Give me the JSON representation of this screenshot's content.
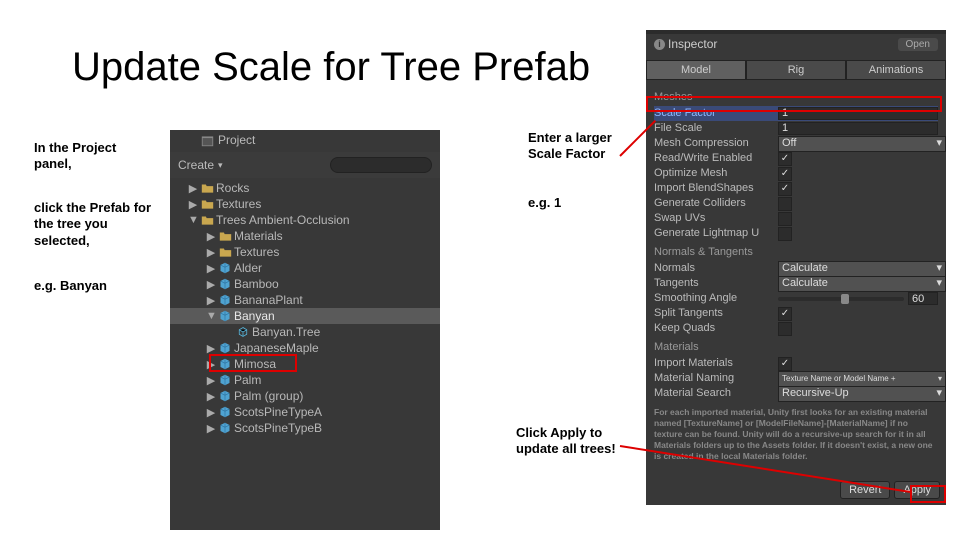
{
  "title": "Update Scale for Tree Prefab",
  "instructions": {
    "left1": "In the Project panel,",
    "left2": "click the Prefab for the tree you selected,",
    "left3": "e.g. Banyan",
    "right1": "Enter a larger Scale Factor",
    "right2": "e.g. 1",
    "right3": "Click Apply to update all trees!"
  },
  "project": {
    "tab": "Project",
    "create": "Create",
    "items": [
      {
        "depth": 2,
        "arrow": "▶",
        "icon": "folder",
        "label": "Rocks"
      },
      {
        "depth": 2,
        "arrow": "▶",
        "icon": "folder",
        "label": "Textures"
      },
      {
        "depth": 2,
        "arrow": "▼",
        "icon": "folder",
        "label": "Trees Ambient-Occlusion"
      },
      {
        "depth": 3,
        "arrow": "▶",
        "icon": "folder",
        "label": "Materials"
      },
      {
        "depth": 3,
        "arrow": "▶",
        "icon": "folder",
        "label": "Textures"
      },
      {
        "depth": 3,
        "arrow": "▶",
        "icon": "prefab",
        "label": "Alder"
      },
      {
        "depth": 3,
        "arrow": "▶",
        "icon": "prefab",
        "label": "Bamboo"
      },
      {
        "depth": 3,
        "arrow": "▶",
        "icon": "prefab",
        "label": "BananaPlant"
      },
      {
        "depth": 3,
        "arrow": "▼",
        "icon": "prefab",
        "label": "Banyan",
        "selected": true
      },
      {
        "depth": 4,
        "arrow": "",
        "icon": "mesh",
        "label": "Banyan.Tree"
      },
      {
        "depth": 3,
        "arrow": "▶",
        "icon": "prefab",
        "label": "JapaneseMaple"
      },
      {
        "depth": 3,
        "arrow": "▶",
        "icon": "prefab",
        "label": "Mimosa"
      },
      {
        "depth": 3,
        "arrow": "▶",
        "icon": "prefab",
        "label": "Palm"
      },
      {
        "depth": 3,
        "arrow": "▶",
        "icon": "prefab",
        "label": "Palm (group)"
      },
      {
        "depth": 3,
        "arrow": "▶",
        "icon": "prefab",
        "label": "ScotsPineTypeA"
      },
      {
        "depth": 3,
        "arrow": "▶",
        "icon": "prefab",
        "label": "ScotsPineTypeB"
      }
    ]
  },
  "inspector": {
    "tab": "Inspector",
    "open": "Open",
    "modelTabs": [
      "Model",
      "Rig",
      "Animations"
    ],
    "activeTab": 0,
    "meshes": {
      "header": "Meshes",
      "scaleFactor": {
        "label": "Scale Factor",
        "value": "1"
      },
      "fileScale": {
        "label": "File Scale",
        "value": "1"
      },
      "meshCompression": {
        "label": "Mesh Compression",
        "value": "Off"
      },
      "readWrite": {
        "label": "Read/Write Enabled",
        "checked": true
      },
      "optimize": {
        "label": "Optimize Mesh",
        "checked": true
      },
      "blend": {
        "label": "Import BlendShapes",
        "checked": true
      },
      "genCol": {
        "label": "Generate Colliders",
        "checked": false
      },
      "swap": {
        "label": "Swap UVs",
        "checked": false
      },
      "lightmap": {
        "label": "Generate Lightmap U",
        "checked": false
      }
    },
    "normals": {
      "header": "Normals & Tangents",
      "normals": {
        "label": "Normals",
        "value": "Calculate"
      },
      "tangents": {
        "label": "Tangents",
        "value": "Calculate"
      },
      "smooth": {
        "label": "Smoothing Angle",
        "value": "60"
      },
      "split": {
        "label": "Split Tangents",
        "checked": true
      },
      "keep": {
        "label": "Keep Quads",
        "checked": false
      }
    },
    "materials": {
      "header": "Materials",
      "import": {
        "label": "Import Materials",
        "checked": true
      },
      "naming": {
        "label": "Material Naming",
        "value": "Texture Name or Model Name +"
      },
      "search": {
        "label": "Material Search",
        "value": "Recursive-Up"
      }
    },
    "hint": "For each imported material, Unity first looks for an existing material named [TextureName] or [ModelFileName]-[MaterialName] if no texture can be found.\nUnity will do a recursive-up search for it in all Materials folders up to the Assets folder.\nIf it doesn't exist, a new one is created in the local Materials folder.",
    "revert": "Revert",
    "apply": "Apply"
  }
}
